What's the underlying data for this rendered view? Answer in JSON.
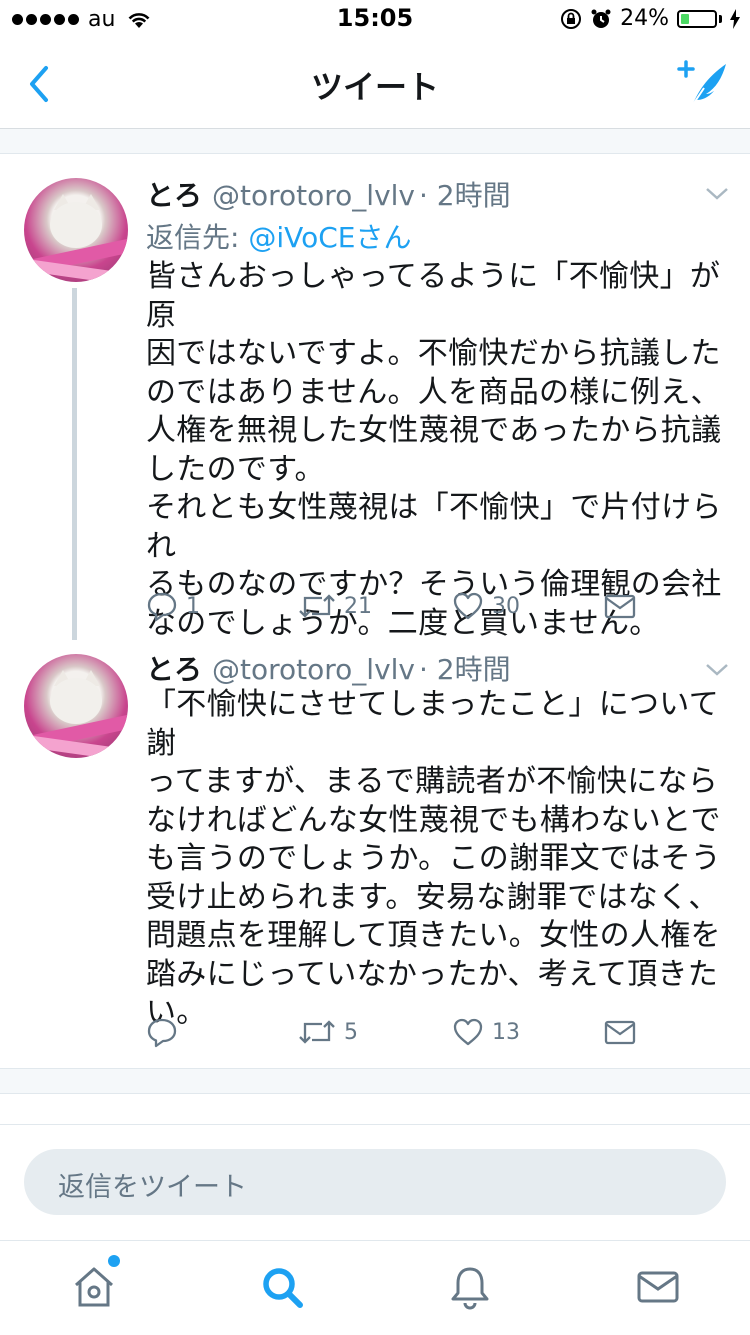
{
  "status_bar": {
    "carrier": "au",
    "time": "15:05",
    "battery": "24%",
    "battery_level": 0.24
  },
  "nav": {
    "title": "ツイート",
    "back_icon": "chevron-left-icon",
    "compose_icon": "compose-tweet-icon"
  },
  "tweets": [
    {
      "name": "とろ",
      "handle": "@torotoro_lvlv",
      "time": "· 2時間",
      "reply_prefix": "返信先: ",
      "reply_to": "@iVoCEさん",
      "text": "皆さんおっしゃってるように「不愉快」が原\n因ではないですよ。不愉快だから抗議した\nのではありません。人を商品の様に例え、\n人権を無視した女性蔑視であったから抗議\nしたのです。\nそれとも女性蔑視は「不愉快」で片付けられ\nるものなのですか？そういう倫理観の会社\nなのでしょうか。二度と買いません。",
      "replies": "1",
      "retweets": "21",
      "likes": "30"
    },
    {
      "name": "とろ",
      "handle": "@torotoro_lvlv",
      "time": "· 2時間",
      "text": "「不愉快にさせてしまったこと」について謝\nってますが、まるで購読者が不愉快になら\nなければどんな女性蔑視でも構わないとで\nも言うのでしょうか。この謝罪文ではそう\n受け止められます。安易な謝罪ではなく、\n問題点を理解して頂きたい。女性の人権を\n踏みにじっていなかったか、考えて頂きた\nい。",
      "replies": "",
      "retweets": "5",
      "likes": "13"
    }
  ],
  "reply_bar": {
    "placeholder": "返信をツイート"
  },
  "tabbar": {
    "items": [
      "home-icon",
      "search-icon",
      "notifications-icon",
      "messages-icon"
    ],
    "accent": "#1da1f2"
  }
}
